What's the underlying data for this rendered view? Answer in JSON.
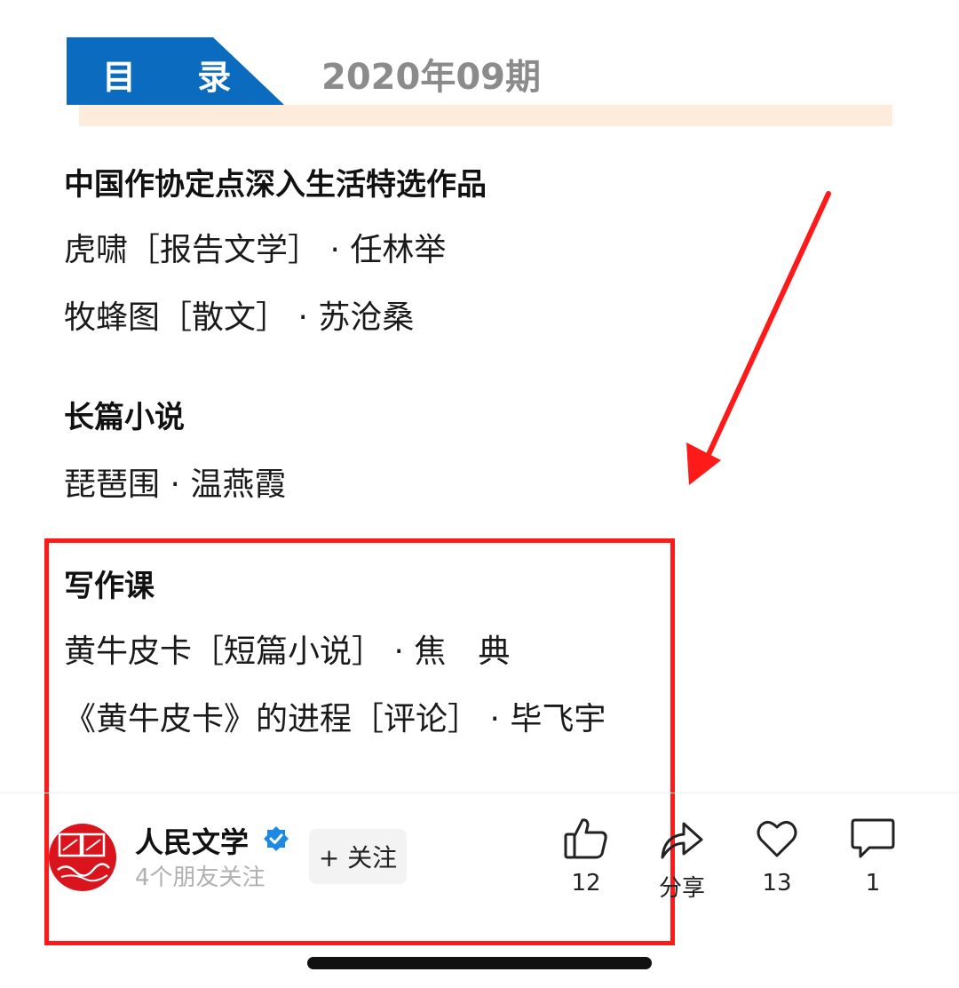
{
  "header": {
    "tag_label": "目 录",
    "issue": "2020年09期"
  },
  "sections": [
    {
      "title": "中国作协定点深入生活特选作品",
      "items": [
        "虎啸［报告文学］ · 任林举",
        "牧蜂图［散文］ · 苏沧桑"
      ]
    },
    {
      "title": "长篇小说",
      "items": [
        "琵琶围 · 温燕霞"
      ]
    },
    {
      "title": "写作课",
      "items": [
        "黄牛皮卡［短篇小说］ · 焦　典",
        "《黄牛皮卡》的进程［评论］ · 毕飞宇"
      ]
    }
  ],
  "footer": {
    "account_name": "人民文学",
    "followers": "4个朋友关注",
    "follow_label": "+ 关注",
    "like_count": "12",
    "share_label": "分享",
    "favorite_count": "13",
    "comment_count": "1"
  },
  "colors": {
    "accent": "#0a6bbf",
    "band": "#fdebdc",
    "annotation": "#ff1a1a",
    "verified": "#1e88e5",
    "avatar": "#d9141d"
  },
  "icons": [
    "thumbs-up-icon",
    "share-arrow-icon",
    "heart-icon",
    "comment-icon",
    "verified-badge-icon",
    "annotation-arrow"
  ]
}
